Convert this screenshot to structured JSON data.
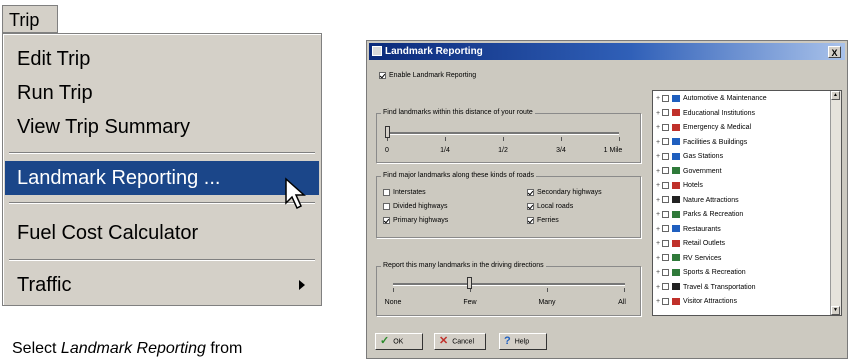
{
  "menu": {
    "title": "Trip",
    "items": [
      {
        "label": "Edit Trip"
      },
      {
        "label": "Run Trip"
      },
      {
        "label": "View Trip Summary"
      },
      {
        "label": "Landmark Reporting ..."
      },
      {
        "label": "Fuel Cost Calculator"
      },
      {
        "label": "Traffic"
      }
    ]
  },
  "caption": {
    "prefix": "Select ",
    "emphasis": "Landmark Reporting",
    "suffix": " from"
  },
  "dialog": {
    "title": "Landmark Reporting",
    "close": "X",
    "enable_label": "Enable Landmark Reporting",
    "enable_checked": true,
    "distance": {
      "title": "Find landmarks within this distance of your route",
      "ticks": [
        "0",
        "1/4",
        "1/2",
        "3/4",
        "1 Mile"
      ],
      "value": "0"
    },
    "roads": {
      "title": "Find major landmarks along these kinds of roads",
      "options": [
        {
          "label": "Interstates",
          "checked": false
        },
        {
          "label": "Secondary highways",
          "checked": true
        },
        {
          "label": "Divided highways",
          "checked": false
        },
        {
          "label": "Local roads",
          "checked": true
        },
        {
          "label": "Primary highways",
          "checked": true
        },
        {
          "label": "Ferries",
          "checked": true
        }
      ]
    },
    "report": {
      "title": "Report this many landmarks in the driving directions",
      "ticks": [
        "None",
        "Few",
        "Many",
        "All"
      ],
      "value": "Few"
    },
    "categories": [
      {
        "label": "Automotive & Maintenance",
        "icon": "car-icon",
        "color": "#1f5fbf"
      },
      {
        "label": "Educational Institutions",
        "icon": "school-icon",
        "color": "#c0302a"
      },
      {
        "label": "Emergency & Medical",
        "icon": "medical-icon",
        "color": "#c0302a"
      },
      {
        "label": "Facilities & Buildings",
        "icon": "building-icon",
        "color": "#1f5fbf"
      },
      {
        "label": "Gas Stations",
        "icon": "gas-icon",
        "color": "#1f5fbf"
      },
      {
        "label": "Government",
        "icon": "government-icon",
        "color": "#2f7a3a"
      },
      {
        "label": "Hotels",
        "icon": "hotel-icon",
        "color": "#c0302a"
      },
      {
        "label": "Nature Attractions",
        "icon": "tree-icon",
        "color": "#222222"
      },
      {
        "label": "Parks & Recreation",
        "icon": "park-icon",
        "color": "#2f7a3a"
      },
      {
        "label": "Restaurants",
        "icon": "restaurant-icon",
        "color": "#1f5fbf"
      },
      {
        "label": "Retail Outlets",
        "icon": "retail-icon",
        "color": "#c0302a"
      },
      {
        "label": "RV Services",
        "icon": "rv-icon",
        "color": "#2f7a3a"
      },
      {
        "label": "Sports & Recreation",
        "icon": "sports-icon",
        "color": "#2f7a3a"
      },
      {
        "label": "Travel & Transportation",
        "icon": "travel-icon",
        "color": "#222222"
      },
      {
        "label": "Visitor Attractions",
        "icon": "attraction-icon",
        "color": "#c0302a"
      }
    ],
    "buttons": {
      "ok": "OK",
      "cancel": "Cancel",
      "help": "Help"
    }
  }
}
